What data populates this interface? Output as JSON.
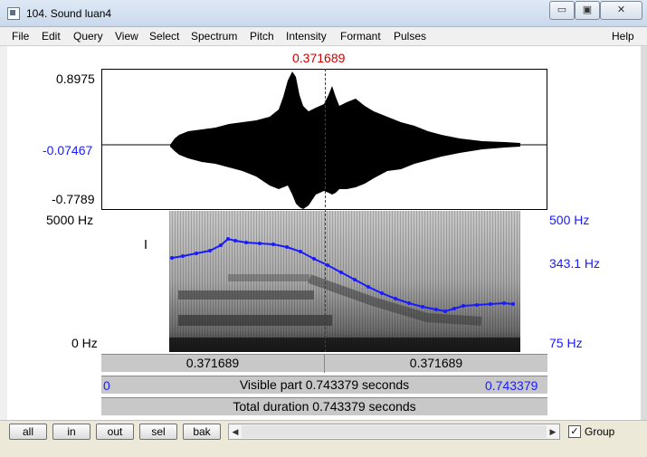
{
  "window": {
    "title": "104. Sound luan4",
    "min_label": "▭",
    "max_label": "▣",
    "close_label": "✕"
  },
  "menu": [
    "File",
    "Edit",
    "Query",
    "View",
    "Select",
    "Spectrum",
    "Pitch",
    "Intensity",
    "Formant",
    "Pulses"
  ],
  "menu_help": "Help",
  "editor": {
    "cursor_time": "0.371689",
    "wave_max": "0.8975",
    "wave_mid": "-0.07467",
    "wave_min": "-0.7789",
    "spec_top": "5000 Hz",
    "spec_bottom": "0 Hz",
    "pitch_top": "500 Hz",
    "pitch_mid": "343.1 Hz",
    "pitch_bottom": "75 Hz",
    "left_segment": "0.371689",
    "right_segment": "0.371689",
    "visible_start": "0",
    "visible_part": "Visible part 0.743379 seconds",
    "visible_end": "0.743379",
    "total_duration": "Total duration 0.743379 seconds",
    "colors": {
      "cursor": "#d00000",
      "pitch": "#1a1aff"
    }
  },
  "buttons": {
    "all": "all",
    "in": "in",
    "out": "out",
    "sel": "sel",
    "bak": "bak"
  },
  "group": {
    "label": "Group",
    "checked": "✓"
  }
}
